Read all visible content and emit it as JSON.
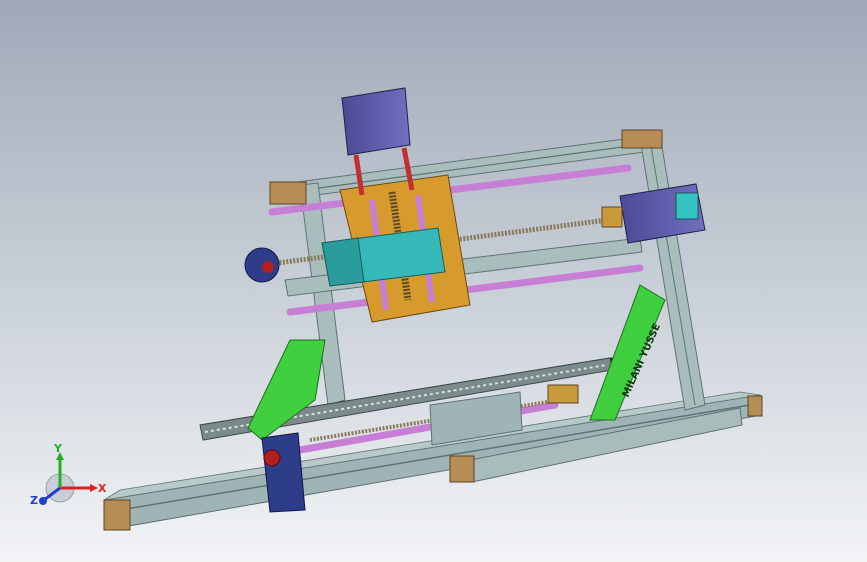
{
  "viewport": {
    "background_top": "#9fa9b8",
    "background_bottom": "#f2f4f6"
  },
  "model": {
    "z_axis_label_text": "MILANI YUSSE",
    "colors": {
      "frame": "#9fb4b4",
      "frame_dark": "#5f7373",
      "stepper_motor": "#5a5aa8",
      "rod": "#c77fd6",
      "z_carriage": "#d69b2c",
      "spindle": "#34b8b8",
      "side_bracket": "#3fcf3f",
      "leadscrew_tint": "#c89a3a",
      "idler": "#2d3d8a",
      "bed": "#2a2a2a",
      "foot": "#b78d55",
      "spring": "#d02020"
    }
  },
  "triad": {
    "x_label": "X",
    "y_label": "Y",
    "z_label": "Z",
    "x_color": "#e02020",
    "y_color": "#20b020",
    "z_color": "#2040d0"
  }
}
